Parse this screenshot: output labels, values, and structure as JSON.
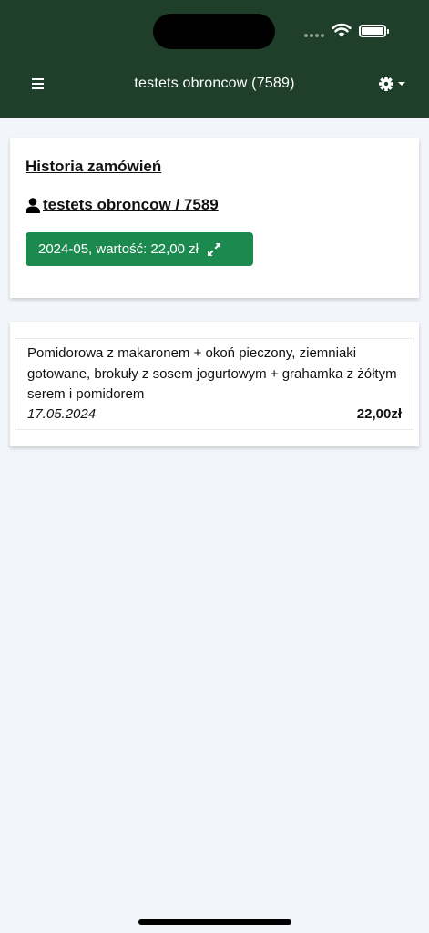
{
  "navbar": {
    "title": "testets obroncow (7589)",
    "menu_icon": "hamburger-icon",
    "settings_icon": "gear-icon"
  },
  "history_card": {
    "title": "Historia zamówień",
    "user_label": "testets obroncow / 7589",
    "month_button_label": "2024-05, wartość: 22,00 zł"
  },
  "orders": [
    {
      "description": "Pomidorowa z makaronem + okoń pieczony, ziemniaki gotowane, brokuły z sosem jogurtowym + grahamka z żółtym serem i pomidorem",
      "date": "17.05.2024",
      "price": "22,00zł"
    }
  ],
  "colors": {
    "header_bg": "#1f3f2a",
    "accent_green": "#1c8a4f",
    "page_bg": "#f2f5fa"
  }
}
